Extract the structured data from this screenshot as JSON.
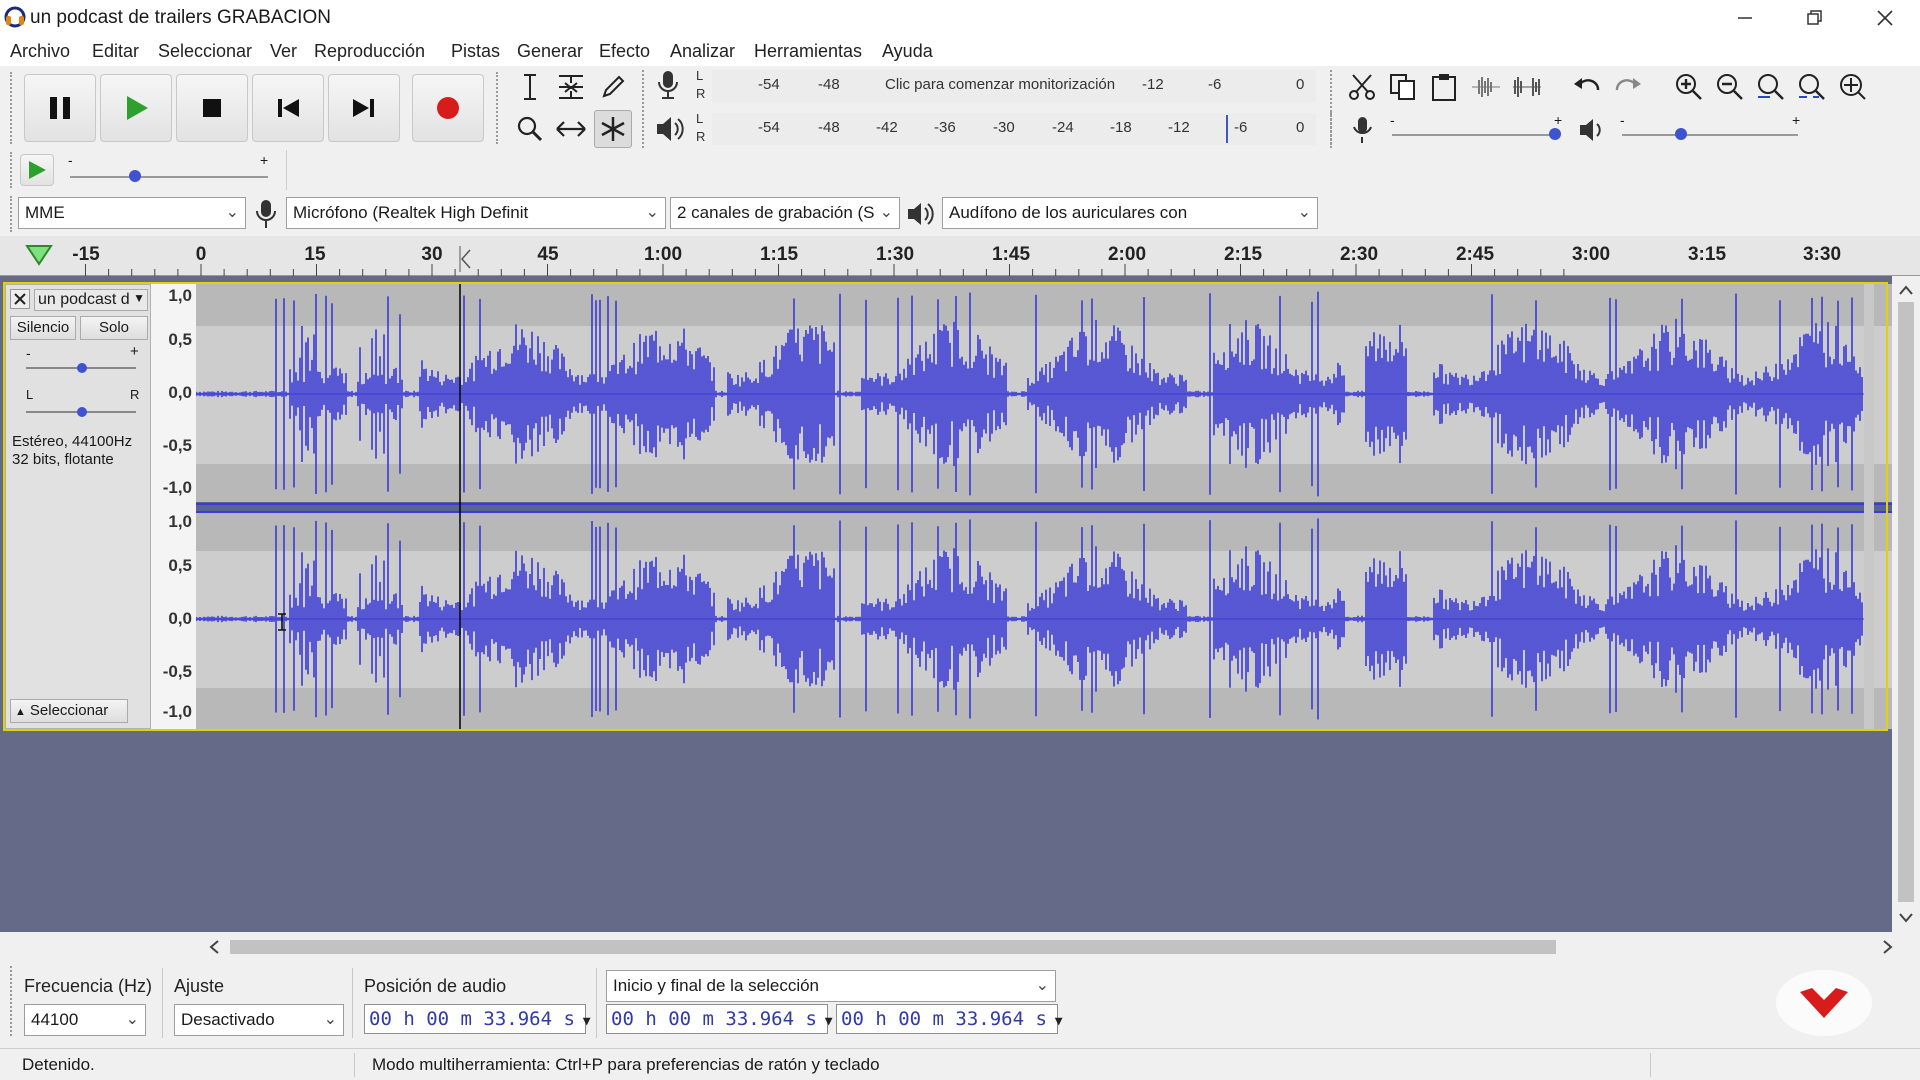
{
  "window": {
    "title": "un podcast de trailers GRABACION"
  },
  "menu": [
    "Archivo",
    "Editar",
    "Seleccionar",
    "Ver",
    "Reproducción",
    "Pistas",
    "Generar",
    "Efecto",
    "Analizar",
    "Herramientas",
    "Ayuda"
  ],
  "meters": {
    "record_scale": [
      "-54",
      "-48",
      "-12",
      "-6",
      "0"
    ],
    "record_prompt": "Clic para comenzar monitorización",
    "play_scale": [
      "-54",
      "-48",
      "-42",
      "-36",
      "-30",
      "-24",
      "-18",
      "-12",
      "-6",
      "0"
    ],
    "channel_L": "L",
    "channel_R": "R"
  },
  "devices": {
    "host": "MME",
    "input": "Micrófono (Realtek High Definit",
    "channels": "2 canales de grabación (S",
    "output": "Audífono de los auriculares con"
  },
  "ruler": {
    "labels": [
      "-15",
      "0",
      "15",
      "30",
      "45",
      "1:00",
      "1:15",
      "1:30",
      "1:45",
      "2:00",
      "2:15",
      "2:30",
      "2:45",
      "3:00",
      "3:15",
      "3:30"
    ]
  },
  "track": {
    "name": "un podcast d",
    "mute_label": "Silencio",
    "solo_label": "Solo",
    "gain_minus": "-",
    "gain_plus": "+",
    "pan_left": "L",
    "pan_right": "R",
    "format_line1": "Estéreo, 44100Hz",
    "format_line2": "32 bits, flotante",
    "select_label": "Seleccionar",
    "scale_labels": [
      "1,0",
      "0,5",
      "0,0",
      "-0,5",
      "-1,0"
    ]
  },
  "selection_bar": {
    "rate_label": "Frecuencia (Hz)",
    "rate_value": "44100",
    "snap_label": "Ajuste",
    "snap_value": "Desactivado",
    "position_label": "Posición de audio",
    "position_value": "00 h 00 m 33.964 s",
    "selection_mode": "Inicio y final de la selección",
    "start_value": "00 h 00 m 33.964 s",
    "end_value": "00 h 00 m 33.964 s"
  },
  "status": {
    "state": "Detenido.",
    "hint": "Modo multiherramienta: Ctrl+P para preferencias de ratón y teclado"
  },
  "colors": {
    "wave": "#3a3ad6",
    "track_bg": "#646a87",
    "record": "#d81b1b",
    "play": "#2ea02e",
    "selected_frame": "#e4d200"
  }
}
